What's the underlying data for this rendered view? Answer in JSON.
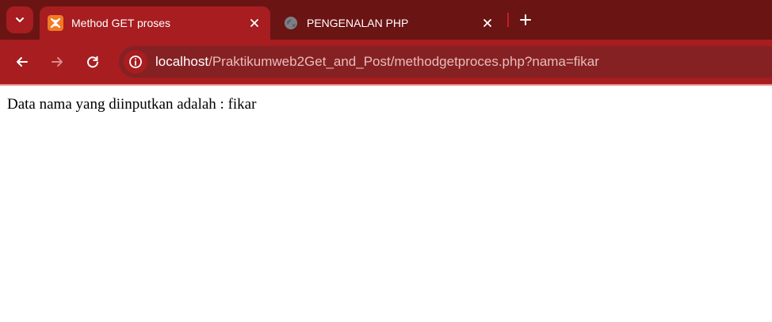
{
  "browser": {
    "tabs": [
      {
        "title": "Method GET proses",
        "active": true,
        "favicon": "xampp-icon"
      },
      {
        "title": "PENGENALAN PHP",
        "active": false,
        "favicon": "globe-icon"
      }
    ],
    "toolbar": {
      "back_icon": "back-arrow-icon",
      "forward_icon": "forward-arrow-icon",
      "reload_icon": "reload-icon",
      "site_info_icon": "info-icon"
    },
    "address_bar": {
      "host": "localhost",
      "path": "/Praktikumweb2Get_and_Post/methodgetproces.php?nama=fikar"
    },
    "theme": {
      "tabstrip": "#6b1414",
      "toolbar": "#a71d20",
      "omnibox": "#862123",
      "xampp": "#f07b24"
    }
  },
  "page": {
    "text": "Data nama yang diinputkan adalah : fikar"
  }
}
